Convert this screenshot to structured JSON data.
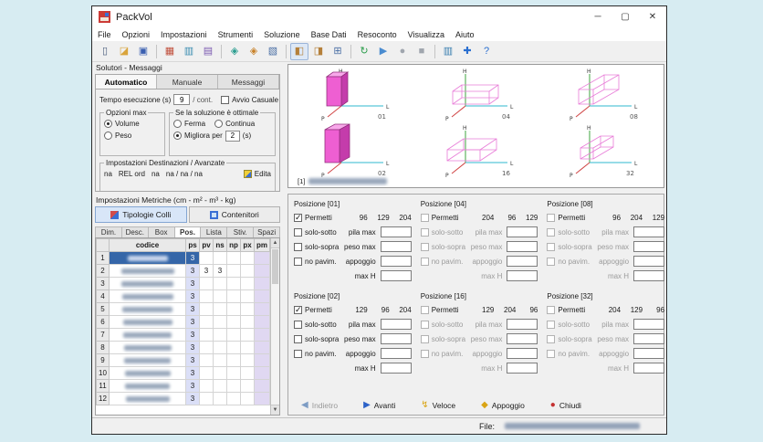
{
  "window": {
    "title": "PackVol",
    "minimize": "─",
    "maximize": "▢",
    "close": "✕"
  },
  "menu": {
    "items": [
      "File",
      "Opzioni",
      "Impostazioni",
      "Strumenti",
      "Soluzione",
      "Base Dati",
      "Resoconto",
      "Visualizza",
      "Aiuto"
    ]
  },
  "toolbar": {
    "buttons": [
      {
        "name": "new-document-icon",
        "glyph": "▯",
        "color": "#4a5d7d"
      },
      {
        "name": "open-folder-icon",
        "glyph": "◪",
        "color": "#d9a43b"
      },
      {
        "name": "save-icon",
        "glyph": "▣",
        "color": "#3a5fb0"
      },
      {
        "sep": true
      },
      {
        "name": "colli-data-icon",
        "glyph": "▦",
        "color": "#c0503c"
      },
      {
        "name": "contenitori-data-icon",
        "glyph": "▥",
        "color": "#3a8cb0"
      },
      {
        "name": "destinazioni-data-icon",
        "glyph": "▤",
        "color": "#7a58b0"
      },
      {
        "sep": true
      },
      {
        "name": "solutore-icon",
        "glyph": "◈",
        "color": "#2a9d8f"
      },
      {
        "name": "soluzione-icon",
        "glyph": "◈",
        "color": "#c8822a"
      },
      {
        "name": "resoconto-icon",
        "glyph": "▧",
        "color": "#4a6fa5"
      },
      {
        "sep": true
      },
      {
        "name": "vista-collo-icon",
        "glyph": "◧",
        "color": "#b5803a",
        "pressed": true
      },
      {
        "name": "vista-carico-icon",
        "glyph": "◨",
        "color": "#b5803a"
      },
      {
        "name": "vista-griglia-icon",
        "glyph": "⊞",
        "color": "#4a6fa5"
      },
      {
        "sep": true
      },
      {
        "name": "aggiorna-icon",
        "glyph": "↻",
        "color": "#2a9d4a"
      },
      {
        "name": "avvia-icon",
        "glyph": "▶",
        "color": "#4a8cd0"
      },
      {
        "name": "registra-icon",
        "glyph": "●",
        "color": "#a0a6ae"
      },
      {
        "name": "ferma-icon",
        "glyph": "■",
        "color": "#a0a6ae"
      },
      {
        "sep": true
      },
      {
        "name": "grafico-icon",
        "glyph": "▥",
        "color": "#3a7fb0"
      },
      {
        "name": "adatta-vista-icon",
        "glyph": "✚",
        "color": "#2a6fd0"
      },
      {
        "name": "aiuto-icon",
        "glyph": "?",
        "color": "#2a6fd0"
      }
    ]
  },
  "solver": {
    "header": "Solutori - Messaggi",
    "tabs": [
      "Automatico",
      "Manuale",
      "Messaggi"
    ],
    "active_tab": "Automatico",
    "tempo_label": "Tempo esecuzione (s)",
    "tempo_value": "9",
    "cont_label": "/ cont.",
    "avvio_casuale": "Avvio Casuale",
    "opzioni_max": {
      "title": "Opzioni max",
      "volume": "Volume",
      "peso": "Peso"
    },
    "ottimale": {
      "title": "Se la soluzione è ottimale",
      "ferma": "Ferma",
      "continua": "Continua",
      "migliora": "Migliora per",
      "valore": "2",
      "unita": "(s)"
    },
    "destinazioni": {
      "title": "Impostazioni Destinazioni / Avanzate",
      "campi": [
        "na",
        "REL ord",
        "na",
        "na / na / na"
      ],
      "edita": "Edita"
    }
  },
  "metriche": {
    "header": "Impostazioni Metriche (cm - m² - m³ - kg)",
    "tabs": [
      "Tipologie Colli",
      "Contenitori"
    ],
    "active_tab": "Tipologie Colli",
    "sub_tabs": [
      "Dim.",
      "Desc.",
      "Box",
      "Pos.",
      "Lista",
      "Stiv.",
      "Spazi"
    ],
    "active_sub_tab": "Pos.",
    "table": {
      "columns": [
        "codice",
        "ps",
        "pv",
        "ns",
        "np",
        "px",
        "pm"
      ],
      "rows": [
        {
          "n": "1",
          "ps": "3",
          "selected": true
        },
        {
          "n": "2",
          "ps": "3",
          "pv": "3",
          "ns": "3"
        },
        {
          "n": "3",
          "ps": "3"
        },
        {
          "n": "4",
          "ps": "3"
        },
        {
          "n": "5",
          "ps": "3"
        },
        {
          "n": "6",
          "ps": "3"
        },
        {
          "n": "7",
          "ps": "3"
        },
        {
          "n": "8",
          "ps": "3"
        },
        {
          "n": "9",
          "ps": "3"
        },
        {
          "n": "10",
          "ps": "3"
        },
        {
          "n": "11",
          "ps": "3"
        },
        {
          "n": "12",
          "ps": "3"
        }
      ]
    }
  },
  "viewer": {
    "axes": {
      "h": "H",
      "l": "L",
      "p": "P"
    },
    "boxes": [
      {
        "label": "01"
      },
      {
        "label": "04"
      },
      {
        "label": "08"
      },
      {
        "label": "02"
      },
      {
        "label": "16"
      },
      {
        "label": "32"
      }
    ],
    "caption": "[1]"
  },
  "positions": {
    "labels": {
      "permetti": "Permetti",
      "solo_sotto": "solo-sotto",
      "solo_sopra": "solo-sopra",
      "no_pavim": "no pavim.",
      "pila_max": "pila max",
      "peso_max": "peso max",
      "appoggio": "appoggio",
      "max_h": "max H"
    },
    "panels": [
      {
        "title": "Posizione [01]",
        "enabled": true,
        "permetti": true,
        "dims": [
          "96",
          "129",
          "204"
        ]
      },
      {
        "title": "Posizione [04]",
        "enabled": false,
        "permetti": false,
        "dims": [
          "204",
          "96",
          "129"
        ]
      },
      {
        "title": "Posizione [08]",
        "enabled": false,
        "permetti": false,
        "dims": [
          "96",
          "204",
          "129"
        ]
      },
      {
        "title": "Posizione [02]",
        "enabled": true,
        "permetti": true,
        "dims": [
          "129",
          "96",
          "204"
        ]
      },
      {
        "title": "Posizione [16]",
        "enabled": false,
        "permetti": false,
        "dims": [
          "129",
          "204",
          "96"
        ]
      },
      {
        "title": "Posizione [32]",
        "enabled": false,
        "permetti": false,
        "dims": [
          "204",
          "129",
          "96"
        ]
      }
    ]
  },
  "footer": {
    "buttons": [
      {
        "name": "indietro-button",
        "label": "Indietro",
        "glyph": "◀",
        "color": "#7d9cc4",
        "disabled": true
      },
      {
        "name": "avanti-button",
        "label": "Avanti",
        "glyph": "▶",
        "color": "#2c62c8"
      },
      {
        "name": "veloce-button",
        "label": "Veloce",
        "glyph": "↯",
        "color": "#d9a414"
      },
      {
        "name": "appoggio-button",
        "label": "Appoggio",
        "glyph": "◆",
        "color": "#d9a414"
      },
      {
        "name": "chiudi-button",
        "label": "Chiudi",
        "glyph": "●",
        "color": "#c43232"
      }
    ]
  },
  "statusbar": {
    "file_label": "File:"
  }
}
